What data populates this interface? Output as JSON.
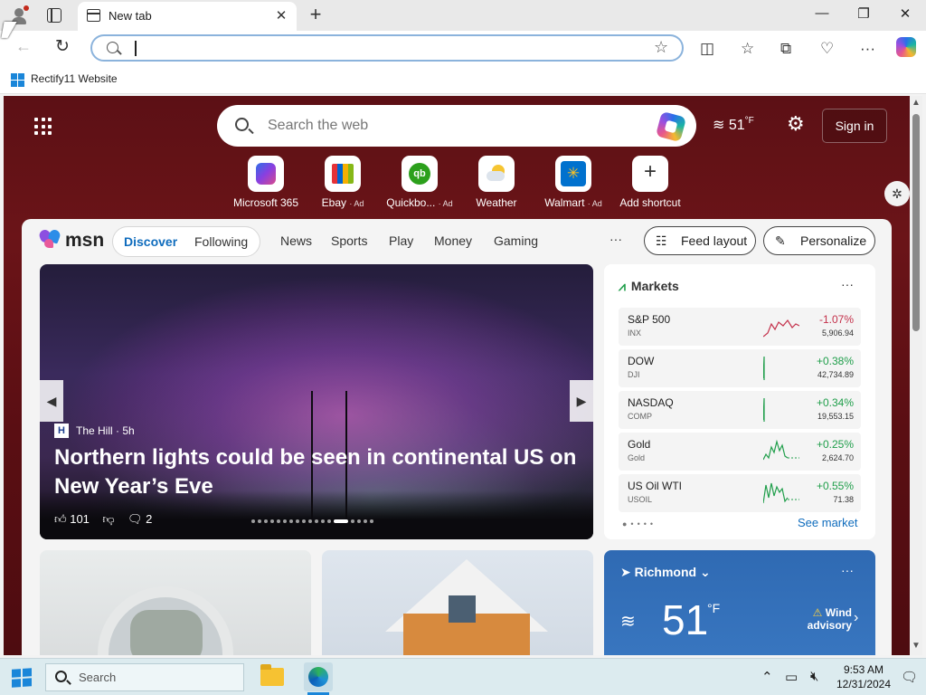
{
  "browser": {
    "tab_title": "New tab",
    "bookmark_label": "Rectify11 Website"
  },
  "msn": {
    "search_placeholder": "Search the web",
    "weather_temp": "51",
    "weather_unit": "°F",
    "sign_in": "Sign in",
    "shortcuts": [
      {
        "label": "Microsoft 365",
        "ad": ""
      },
      {
        "label": "Ebay",
        "ad": "· Ad"
      },
      {
        "label": "Quickbo...",
        "ad": "· Ad"
      },
      {
        "label": "Weather",
        "ad": ""
      },
      {
        "label": "Walmart",
        "ad": "· Ad"
      },
      {
        "label": "Add shortcut",
        "ad": ""
      }
    ],
    "logo_text": "msn",
    "tabs": {
      "discover": "Discover",
      "following": "Following"
    },
    "nav": [
      "News",
      "Sports",
      "Play",
      "Money",
      "Gaming"
    ],
    "more": "···",
    "feed_layout": "Feed layout",
    "personalize": "Personalize"
  },
  "hero": {
    "source_initial": "H",
    "source": "The Hill · 5h",
    "headline": "Northern lights could be seen in continental US on New Year’s Eve",
    "likes": "101",
    "comments": "2"
  },
  "markets": {
    "title": "Markets",
    "rows": [
      {
        "name": "S&P 500",
        "symbol": "INX",
        "change": "-1.07%",
        "value": "5,906.94",
        "dir": "down"
      },
      {
        "name": "DOW",
        "symbol": "DJI",
        "change": "+0.38%",
        "value": "42,734.89",
        "dir": "up"
      },
      {
        "name": "NASDAQ",
        "symbol": "COMP",
        "change": "+0.34%",
        "value": "19,553.15",
        "dir": "up"
      },
      {
        "name": "Gold",
        "symbol": "Gold",
        "change": "+0.25%",
        "value": "2,624.70",
        "dir": "up"
      },
      {
        "name": "US Oil WTI",
        "symbol": "USOIL",
        "change": "+0.55%",
        "value": "71.38",
        "dir": "up"
      }
    ],
    "see_market": "See market"
  },
  "weather_card": {
    "location": "Richmond",
    "temp": "51",
    "unit": "°F",
    "advisory": "Wind advisory"
  },
  "taskbar": {
    "search_placeholder": "Search",
    "time": "9:53 AM",
    "date": "12/31/2024"
  },
  "colors": {
    "accent": "#0f6cbd",
    "up": "#1f9e4a",
    "down": "#c4314b",
    "page_bg": "#5c1015"
  }
}
